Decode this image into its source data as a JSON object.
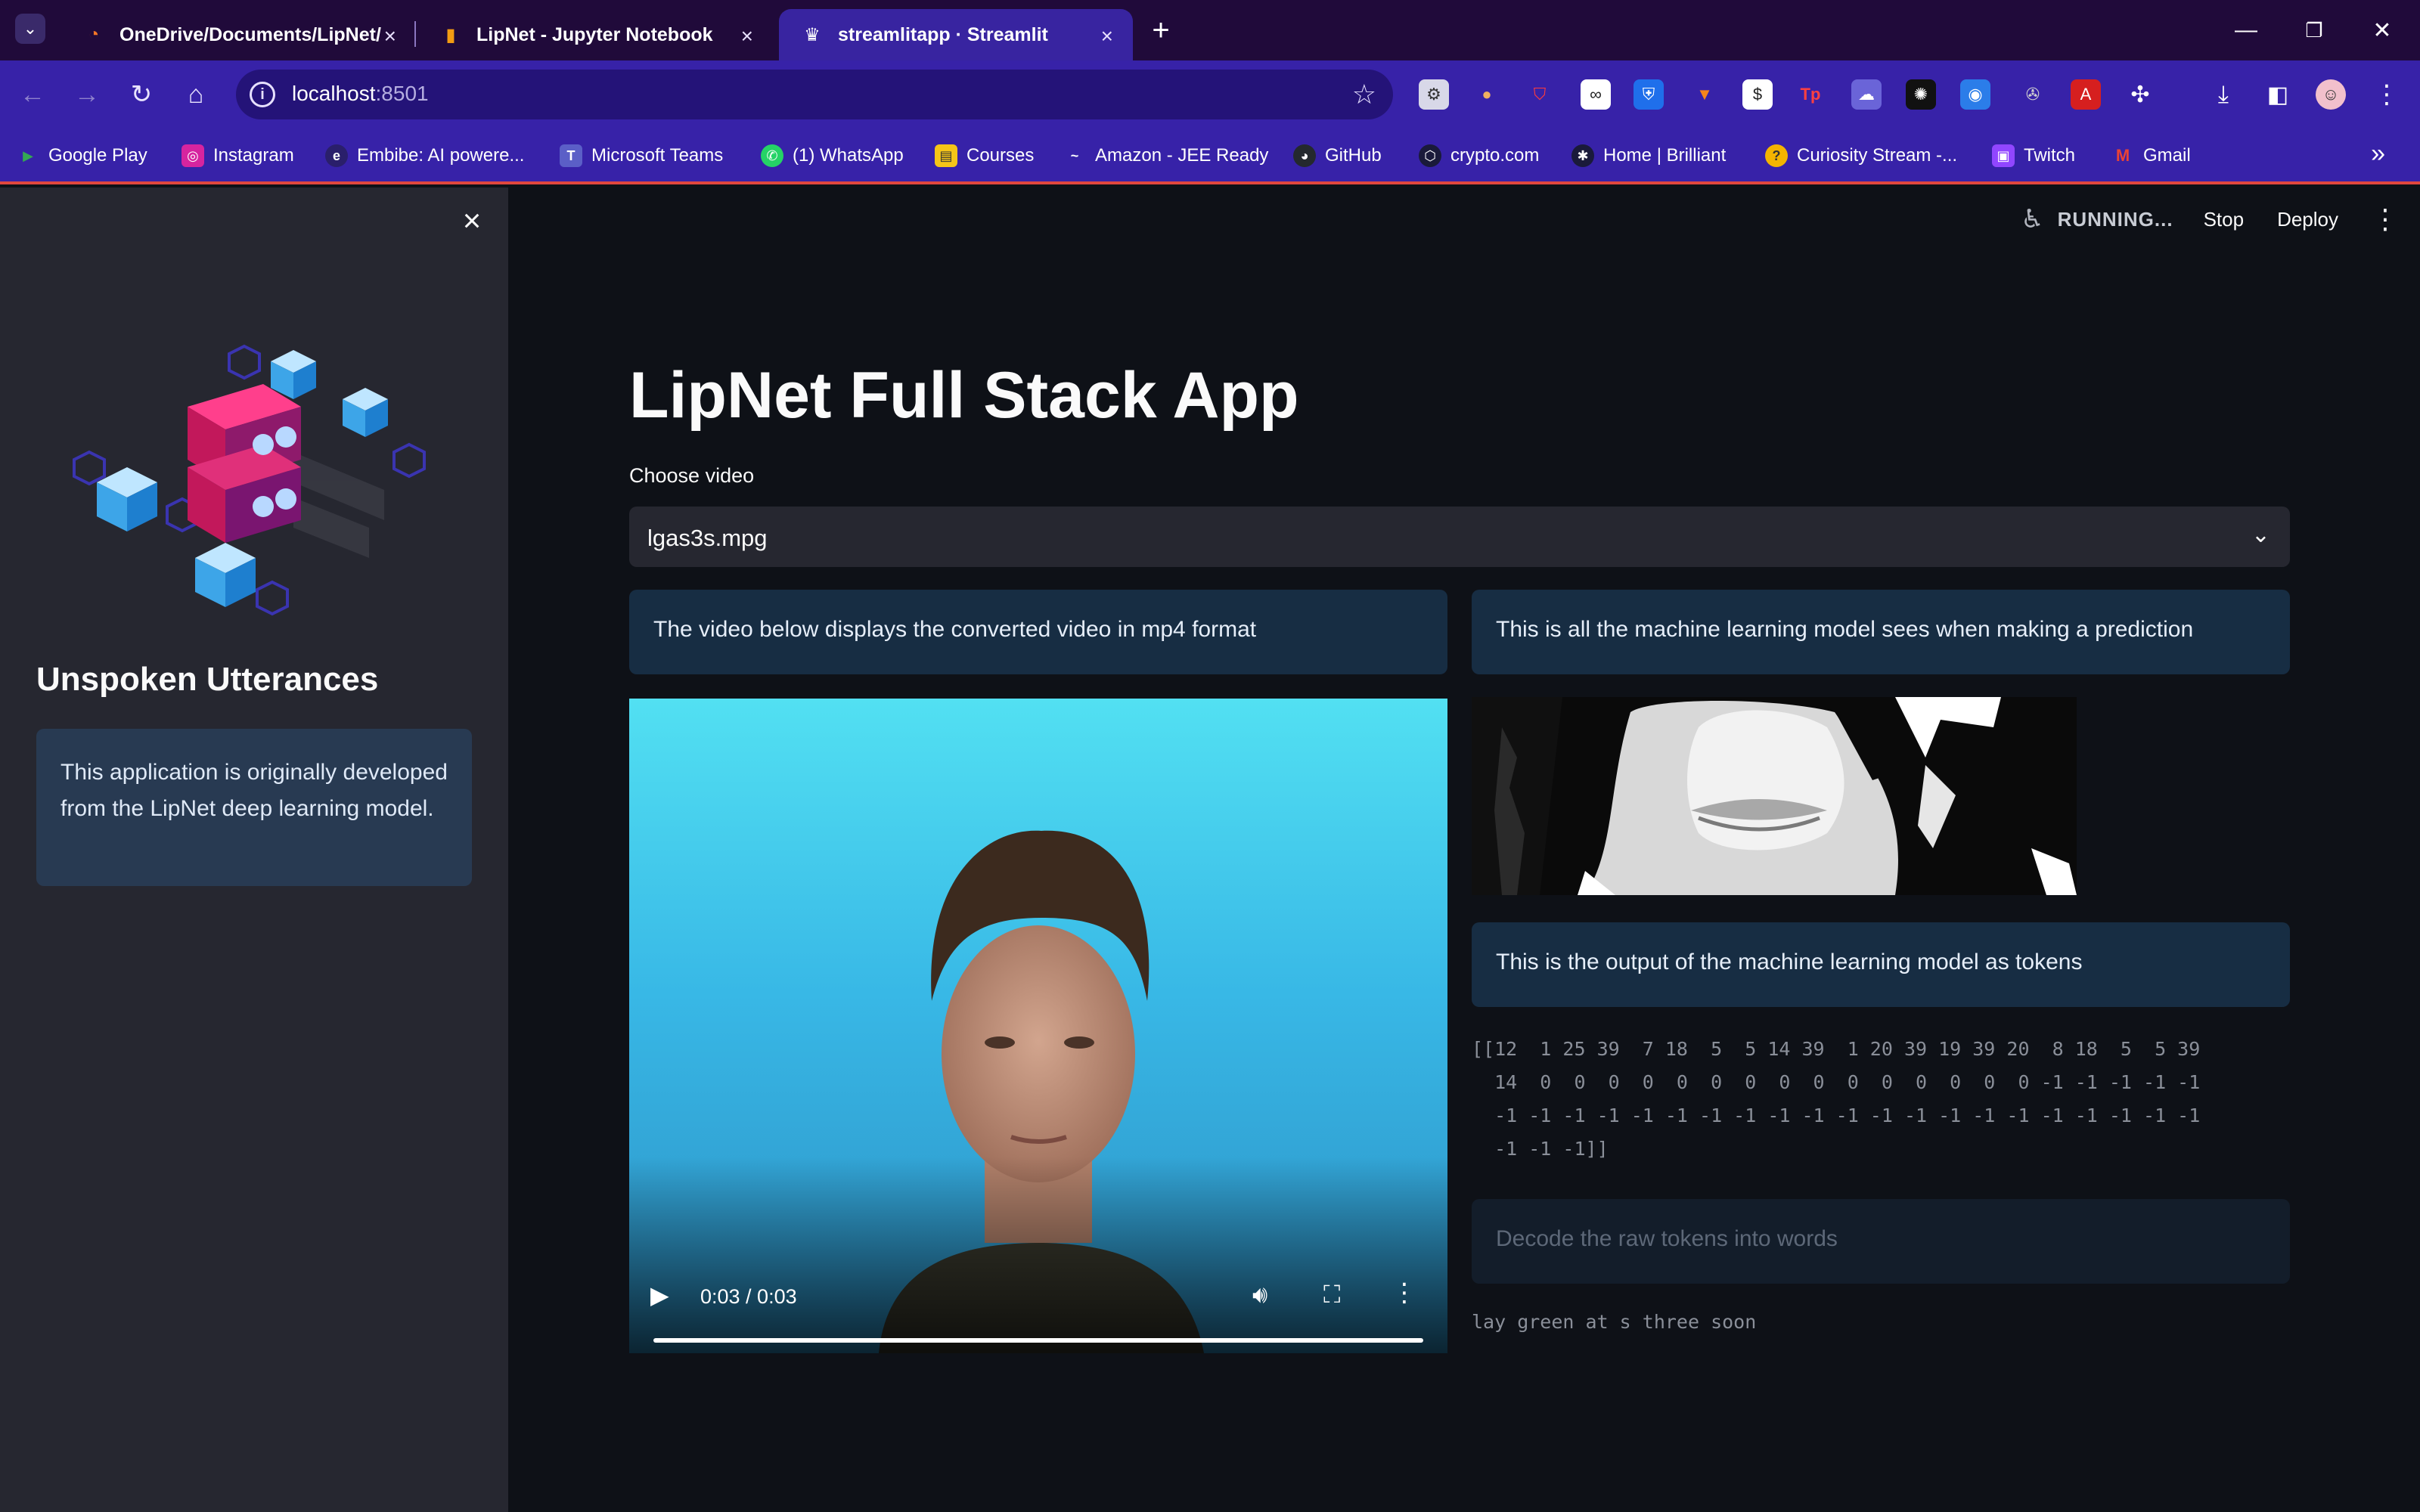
{
  "browser": {
    "tabs": [
      {
        "title": "OneDrive/Documents/LipNet/",
        "icon": "jupyter-icon"
      },
      {
        "title": "LipNet - Jupyter Notebook",
        "icon": "notebook-icon"
      },
      {
        "title": "streamlitapp · Streamlit",
        "icon": "streamlit-icon",
        "active": true
      }
    ],
    "url_host": "localhost",
    "url_port": ":8501",
    "bookmarks": [
      {
        "label": "Google Play",
        "icon": "google-play-icon",
        "color": "#34a853"
      },
      {
        "label": "Instagram",
        "icon": "instagram-icon",
        "color": "#d6249f"
      },
      {
        "label": "Embibe: AI powere...",
        "icon": "embibe-icon",
        "color": "#2a1f6b"
      },
      {
        "label": "Microsoft Teams",
        "icon": "teams-icon",
        "color": "#5b5fc7"
      },
      {
        "label": "(1) WhatsApp",
        "icon": "whatsapp-icon",
        "color": "#25d366"
      },
      {
        "label": "Courses",
        "icon": "courses-icon",
        "color": "#f5c518"
      },
      {
        "label": "Amazon - JEE Ready",
        "icon": "amazon-icon",
        "color": "#3722a8"
      },
      {
        "label": "GitHub",
        "icon": "github-icon",
        "color": "#24292e"
      },
      {
        "label": "crypto.com",
        "icon": "crypto-icon",
        "color": "#1a1a3a"
      },
      {
        "label": "Home | Brilliant",
        "icon": "brilliant-icon",
        "color": "#1a1a3a"
      },
      {
        "label": "Curiosity Stream -...",
        "icon": "curiosity-icon",
        "color": "#f4b400"
      },
      {
        "label": "Twitch",
        "icon": "twitch-icon",
        "color": "#9146ff"
      },
      {
        "label": "Gmail",
        "icon": "gmail-icon",
        "color": "#ea4335"
      }
    ]
  },
  "toolbar": {
    "status": "RUNNING...",
    "stop_label": "Stop",
    "deploy_label": "Deploy"
  },
  "sidebar": {
    "title": "Unspoken Utterances",
    "info": "This application is originally developed from the LipNet deep learning model."
  },
  "main": {
    "title": "LipNet Full Stack App",
    "select_label": "Choose video",
    "selected_video": "lgas3s.mpg",
    "info_video": "The video below displays the converted video in mp4 format",
    "info_model_view": "This is all the machine learning model sees when making a prediction",
    "info_tokens": "This is the output of the machine learning model as tokens",
    "tokens_text": "[[12  1 25 39  7 18  5  5 14 39  1 20 39 19 39 20  8 18  5  5 39\n  14  0  0  0  0  0  0  0  0  0  0  0  0  0  0  0 -1 -1 -1 -1 -1\n  -1 -1 -1 -1 -1 -1 -1 -1 -1 -1 -1 -1 -1 -1 -1 -1 -1 -1 -1 -1 -1\n  -1 -1 -1]]",
    "decode_label": "Decode the raw tokens into words",
    "decoded_text": "lay green at s three soon",
    "video_time": "0:03 / 0:03",
    "video_progress": 1.0
  },
  "colors": {
    "app_bg": "#0e1117",
    "sidebar_bg": "#262730",
    "info_bg": "#172d43",
    "browser_tab_active": "#3824a0",
    "browser_nav": "#3722a8"
  }
}
